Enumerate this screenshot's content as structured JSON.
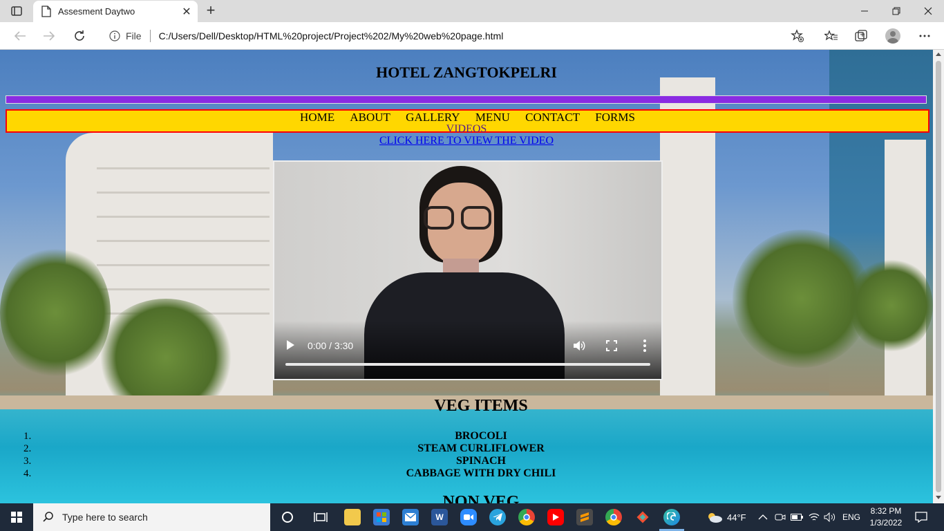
{
  "browser": {
    "tab_title": "Assesment Daytwo",
    "new_tab_symbol": "+",
    "file_label": "File",
    "url": "C:/Users/Dell/Desktop/HTML%20project/Project%202/My%20web%20page.html"
  },
  "page": {
    "title": "HOTEL ZANGTOKPELRI",
    "nav": [
      "HOME",
      "ABOUT",
      "GALLERY",
      "MENU",
      "CONTACT",
      "FORMS"
    ],
    "nav_videos": "VIDEOS",
    "video_link": "CLICK HERE TO VIEW THE VIDEO",
    "video": {
      "time": "0:00 / 3:30",
      "progress": 0
    },
    "veg_title": "VEG ITEMS",
    "list_numbers": [
      "1.",
      "2.",
      "3.",
      "4."
    ],
    "veg_items": [
      "BROCOLI",
      "STEAM CURLIFLOWER",
      "SPINACH",
      "CABBAGE WITH DRY CHILI"
    ],
    "nonveg_title": "NON VEG"
  },
  "taskbar": {
    "search_placeholder": "Type here to search",
    "weather": "44°F",
    "language": "ENG",
    "time": "8:32 PM",
    "date": "1/3/2022",
    "apps": [
      "task-view",
      "file-explorer",
      "microsoft-store",
      "mail",
      "word",
      "zoom",
      "telegram",
      "chrome",
      "youtube",
      "sublime-text",
      "chrome",
      "git",
      "edge"
    ]
  },
  "colors": {
    "nav_bg": "#ffd700",
    "nav_border": "#ff0000",
    "purple_bar": "#8a2be2",
    "link": "#0000ee",
    "visited_link": "#551a8b"
  }
}
